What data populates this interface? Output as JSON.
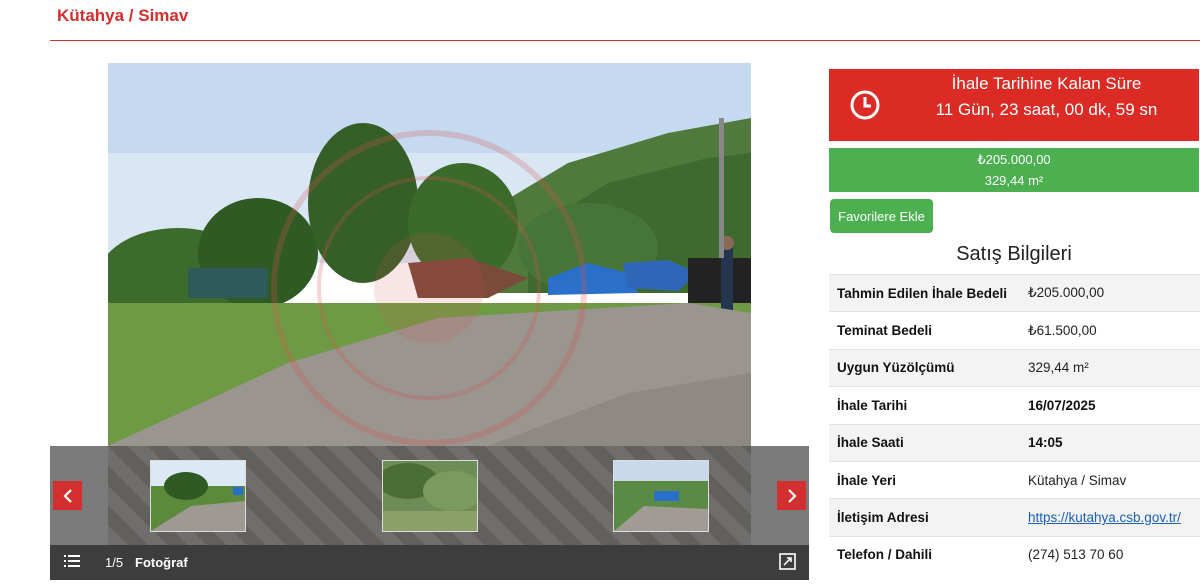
{
  "breadcrumb": "Kütahya / Simav",
  "gallery": {
    "counter": "1/5",
    "label": "Fotoğraf",
    "prev_icon": "chevron-left-icon",
    "next_icon": "chevron-right-icon",
    "list_icon": "list-icon",
    "expand_icon": "expand-icon"
  },
  "timer": {
    "title": "İhale Tarihine Kalan Süre",
    "remaining": "11 Gün, 23 saat, 00 dk, 59 sn",
    "icon": "clock-icon"
  },
  "price": {
    "amount": "₺205.000,00",
    "area": "329,44 m²"
  },
  "favorite_button": "Favorilere Ekle",
  "sales_title": "Satış Bilgileri",
  "rows": [
    {
      "key": "Tahmin Edilen İhale Bedeli",
      "value": "₺205.000,00"
    },
    {
      "key": "Teminat Bedeli",
      "value": "₺61.500,00"
    },
    {
      "key": "Uygun Yüzölçümü",
      "value": "329,44 m²"
    },
    {
      "key": "İhale Tarihi",
      "value": "16/07/2025"
    },
    {
      "key": "İhale Saati",
      "value": "14:05"
    },
    {
      "key": "İhale Yeri",
      "value": "Kütahya / Simav"
    },
    {
      "key": "İletişim Adresi",
      "value": "https://kutahya.csb.gov.tr/"
    },
    {
      "key": "Telefon / Dahili",
      "value": "(274) 513 70 60"
    }
  ],
  "colors": {
    "accent_red": "#dc2a25",
    "accent_green": "#4caf50",
    "link_blue": "#1a5fb4"
  }
}
